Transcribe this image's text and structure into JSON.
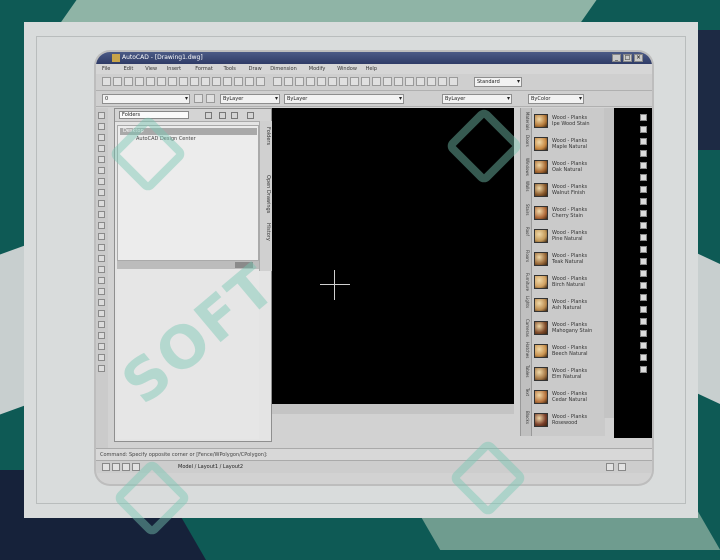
{
  "window": {
    "title": "AutoCAD - [Drawing1.dwg]",
    "minimize": "_",
    "maximize": "□",
    "close": "×"
  },
  "menu": [
    "File",
    "Edit",
    "View",
    "Insert",
    "Format",
    "Tools",
    "Draw",
    "Dimension",
    "Modify",
    "Window",
    "Help"
  ],
  "toolbar": {
    "layer_combo": "0",
    "layer_state": "ByLayer",
    "linetype_combo": "ByLayer",
    "lineweight_combo": "ByLayer",
    "plot_style": "ByColor",
    "workspace": "Standard"
  },
  "design_panel": {
    "search_value": "Folders",
    "tree_root": "Desktop",
    "tree_child": "AutoCAD Design Center",
    "tabs": [
      "Folders",
      "Open Drawings",
      "History"
    ]
  },
  "tool_palette": {
    "tabs": [
      "Materials",
      "Doors",
      "Windows",
      "Walls",
      "Stairs",
      "Roof",
      "Floors",
      "Furniture",
      "Lights",
      "Cameras",
      "Hatches",
      "Tables",
      "Text",
      "Blocks"
    ],
    "items": [
      {
        "line1": "Wood - Planks",
        "line2": "Ipe Wood Stain",
        "color": "#b57a3a"
      },
      {
        "line1": "Wood - Planks",
        "line2": "Maple Natural",
        "color": "#c98a44"
      },
      {
        "line1": "Wood - Planks",
        "line2": "Oak Natural",
        "color": "#a96a33"
      },
      {
        "line1": "Wood - Planks",
        "line2": "Walnut Finish",
        "color": "#8a5a2c"
      },
      {
        "line1": "Wood - Planks",
        "line2": "Cherry Stain",
        "color": "#b06a3a"
      },
      {
        "line1": "Wood - Planks",
        "line2": "Pine Natural",
        "color": "#c49a5a"
      },
      {
        "line1": "Wood - Planks",
        "line2": "Teak Natural",
        "color": "#9a6a3a"
      },
      {
        "line1": "Wood - Planks",
        "line2": "Birch Natural",
        "color": "#d0a060"
      },
      {
        "line1": "Wood - Planks",
        "line2": "Ash Natural",
        "color": "#bd8e52"
      },
      {
        "line1": "Wood - Planks",
        "line2": "Mahogany Stain",
        "color": "#7e4a2a"
      },
      {
        "line1": "Wood - Planks",
        "line2": "Beech Natural",
        "color": "#c9924e"
      },
      {
        "line1": "Wood - Planks",
        "line2": "Elm Natural",
        "color": "#a77a48"
      },
      {
        "line1": "Wood - Planks",
        "line2": "Cedar Natural",
        "color": "#b8743e"
      },
      {
        "line1": "Wood - Planks",
        "line2": "Rosewood",
        "color": "#7a3e2a"
      }
    ]
  },
  "command_line": "Command: Specify opposite corner or [Fence/WPolygon/CPolygon]:",
  "status_bar": "Model / Layout1 / Layout2",
  "watermark": "SOFT"
}
